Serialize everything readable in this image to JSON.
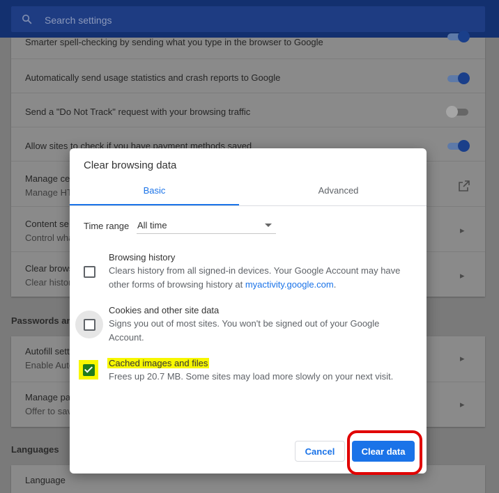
{
  "search": {
    "placeholder": "Search settings"
  },
  "background_rows": [
    {
      "title": "Smarter spell-checking by sending what you type in the browser to Google",
      "toggle": "on"
    },
    {
      "title": "Automatically send usage statistics and crash reports to Google",
      "toggle": "on"
    },
    {
      "title": "Send a \"Do Not Track\" request with your browsing traffic",
      "toggle": "off"
    },
    {
      "title": "Allow sites to check if you have payment methods saved",
      "toggle": "on"
    },
    {
      "title": "Manage ce",
      "sub": "Manage HT"
    },
    {
      "title": "Content se",
      "sub": "Control wha"
    },
    {
      "title": "Clear brows",
      "sub": "Clear histor"
    }
  ],
  "sections": {
    "passwords": "Passwords and",
    "languages": "Languages"
  },
  "autofill_rows": [
    {
      "title": "Autofill sett",
      "sub": "Enable Auto"
    },
    {
      "title": "Manage pa",
      "sub": "Offer to sav"
    }
  ],
  "language_row": {
    "title": "Language"
  },
  "dialog": {
    "title": "Clear browsing data",
    "tabs": {
      "basic": "Basic",
      "advanced": "Advanced"
    },
    "time_range": {
      "label": "Time range",
      "value": "All time"
    },
    "options": [
      {
        "title": "Browsing history",
        "desc_prefix": "Clears history from all signed-in devices. Your Google Account may have other forms of browsing history at ",
        "link": "myactivity.google.com",
        "desc_suffix": ".",
        "checked": false
      },
      {
        "title": "Cookies and other site data",
        "desc": "Signs you out of most sites. You won't be signed out of your Google Account.",
        "checked": false
      },
      {
        "title": "Cached images and files",
        "desc": "Frees up 20.7 MB. Some sites may load more slowly on your next visit.",
        "checked": true
      }
    ],
    "buttons": {
      "cancel": "Cancel",
      "clear": "Clear data"
    }
  },
  "colors": {
    "accent": "#1a73e8",
    "highlight": "#f7f700",
    "annotation": "#e00000",
    "checkbox_checked": "#1e7b1e"
  }
}
